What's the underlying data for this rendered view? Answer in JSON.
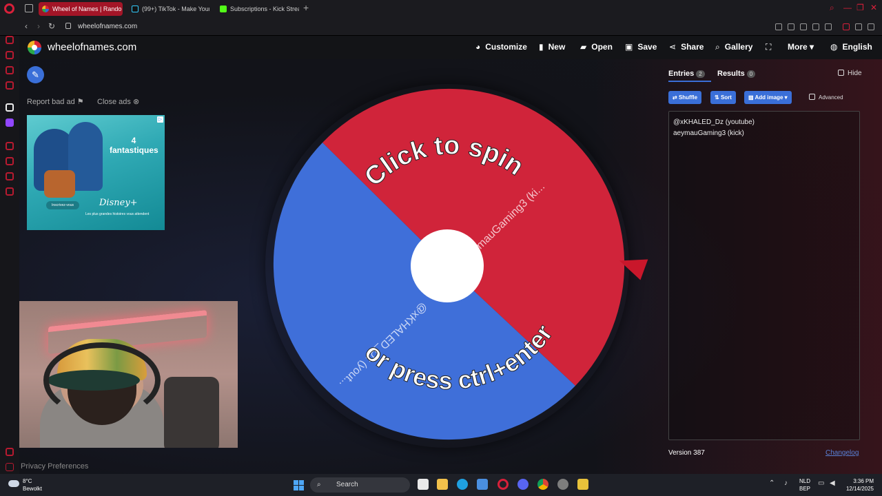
{
  "browser": {
    "tabs": [
      {
        "title": "Wheel of Names | Rando",
        "active": true
      },
      {
        "title": "(99+) TikTok - Make Your",
        "active": false
      },
      {
        "title": "Subscriptions - Kick Strea",
        "active": false
      }
    ],
    "url": "wheelofnames.com"
  },
  "site": {
    "brand": "wheelofnames.com",
    "nav": {
      "customize": "Customize",
      "new": "New",
      "open": "Open",
      "save": "Save",
      "share": "Share",
      "gallery": "Gallery",
      "more": "More",
      "language": "English"
    },
    "ad_links": {
      "report": "Report bad ad",
      "close": "Close ads"
    },
    "ad": {
      "title": "4 fantastiques",
      "button": "Inscrivez-vous",
      "disney": "Disney+",
      "tagline": "Les plus grandes histoires vous attendent"
    },
    "privacy": "Privacy Preferences"
  },
  "wheel": {
    "prompt_top": "Click to spin",
    "prompt_bottom": "or press ctrl+enter",
    "segments": [
      {
        "label": "aeymauGaming3 (ki...",
        "color": "#d0243a"
      },
      {
        "label": "@xKHALED_Dz (yout...",
        "color": "#3f6fd9"
      }
    ]
  },
  "panel": {
    "entries_tab": "Entries",
    "entries_count": "2",
    "results_tab": "Results",
    "results_count": "0",
    "hide_label": "Hide",
    "shuffle": "Shuffle",
    "sort": "Sort",
    "add_image": "Add image",
    "advanced": "Advanced",
    "entries": [
      "@xKHALED_Dz (youtube)",
      "aeymauGaming3 (kick)"
    ],
    "version": "Version 387",
    "changelog": "Changelog"
  },
  "taskbar": {
    "temperature": "8°C",
    "weather": "Bewolkt",
    "search": "Search",
    "lang_line1": "NLD",
    "lang_line2": "BEP",
    "time": "3:36 PM",
    "date": "12/14/2025"
  }
}
